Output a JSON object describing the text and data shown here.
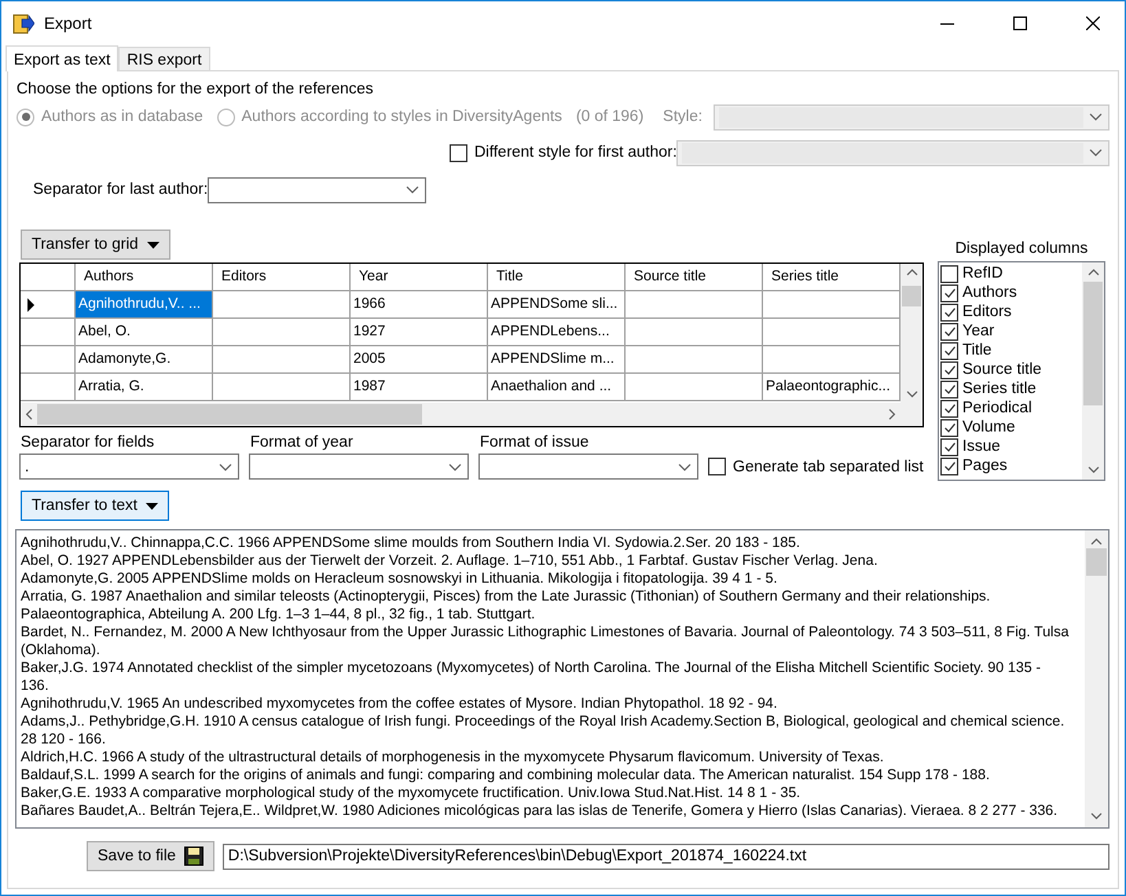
{
  "window": {
    "title": "Export"
  },
  "tabs": [
    {
      "label": "Export as text",
      "selected": true
    },
    {
      "label": "RIS export",
      "selected": false
    }
  ],
  "options": {
    "heading": "Choose the options for the export of the references",
    "author_modes": [
      {
        "label": "Authors as in database",
        "selected": true,
        "disabled": true
      },
      {
        "label": "Authors according to styles in DiversityAgents",
        "selected": false,
        "disabled": true
      }
    ],
    "count": "(0 of 196)",
    "style": {
      "label": "Style:",
      "disabled": true
    },
    "first_author": {
      "label": "Different style for first author:",
      "checked": false,
      "combo_disabled": true
    },
    "separator_last_author": {
      "label": "Separator for last author:"
    }
  },
  "transfer_grid": {
    "label": "Transfer to grid"
  },
  "grid": {
    "columns": [
      "Authors",
      "Editors",
      "Year",
      "Title",
      "Source title",
      "Series title"
    ],
    "rows": [
      {
        "selected": true,
        "cells": [
          "Agnihothrudu,V.. ...",
          "",
          "1966",
          "APPENDSome sli...",
          "",
          ""
        ]
      },
      {
        "selected": false,
        "cells": [
          "Abel, O.",
          "",
          "1927",
          "APPENDLebens...",
          "",
          ""
        ]
      },
      {
        "selected": false,
        "cells": [
          "Adamonyte,G.",
          "",
          "2005",
          "APPENDSlime m...",
          "",
          ""
        ]
      },
      {
        "selected": false,
        "cells": [
          "Arratia, G.",
          "",
          "1987",
          "Anaethalion and ...",
          "",
          "Palaeontographic..."
        ]
      }
    ]
  },
  "displayed_columns": {
    "label": "Displayed columns",
    "items": [
      {
        "label": "RefID",
        "checked": false
      },
      {
        "label": "Authors",
        "checked": true
      },
      {
        "label": "Editors",
        "checked": true
      },
      {
        "label": "Year",
        "checked": true
      },
      {
        "label": "Title",
        "checked": true
      },
      {
        "label": "Source title",
        "checked": true
      },
      {
        "label": "Series title",
        "checked": true
      },
      {
        "label": "Periodical",
        "checked": true
      },
      {
        "label": "Volume",
        "checked": true
      },
      {
        "label": "Issue",
        "checked": true
      },
      {
        "label": "Pages",
        "checked": true
      }
    ]
  },
  "format": {
    "separator_fields": {
      "label": "Separator for fields",
      "value": "."
    },
    "year": {
      "label": "Format of year"
    },
    "issue": {
      "label": "Format of issue"
    },
    "tab_list": {
      "label": "Generate tab separated list",
      "checked": false
    }
  },
  "transfer_text": {
    "label": "Transfer to text"
  },
  "output": {
    "lines": [
      "Agnihothrudu,V.. Chinnappa,C.C. 1966 APPENDSome slime moulds from Southern India VI. Sydowia.2.Ser. 20 183 - 185.",
      "Abel, O. 1927 APPENDLebensbilder aus der Tierwelt der Vorzeit. 2. Auflage. 1–710, 551 Abb., 1 Farbtaf. Gustav Fischer Verlag. Jena.",
      "Adamonyte,G. 2005 APPENDSlime molds on Heracleum sosnowskyi in Lithuania. Mikologija i fitopatologija. 39 4 1 - 5.",
      "Arratia, G. 1987 Anaethalion and similar teleosts (Actinopterygii, Pisces) from the Late Jurassic (Tithonian) of Southern Germany and their relationships.",
      "Palaeontographica, Abteilung A. 200 Lfg. 1–3 1–44, 8 pl., 32 fig., 1 tab. Stuttgart.",
      "Bardet, N.. Fernandez, M. 2000 A New Ichthyosaur from the Upper Jurassic Lithographic Limestones of Bavaria. Journal of Paleontology. 74 3 503–511, 8 Fig. Tulsa",
      "(Oklahoma).",
      "Baker,J.G. 1974 Annotated checklist of the simpler mycetozoans (Myxomycetes) of North Carolina. The Journal of the Elisha Mitchell Scientific Society. 90 135 -",
      "136.",
      "Agnihothrudu,V. 1965 An undescribed myxomycetes from the coffee estates of Mysore. Indian Phytopathol. 18 92 - 94.",
      "Adams,J.. Pethybridge,G.H. 1910 A census catalogue of Irish fungi. Proceedings of the Royal Irish Academy.Section B, Biological, geological and chemical science.",
      "28 120 - 166.",
      "Aldrich,H.C. 1966 A study of the ultrastructural details of morphogenesis in the myxomycete Physarum flavicomum. University of Texas.",
      "Baldauf,S.L. 1999 A search for the origins of animals and fungi: comparing and combining molecular data. The American naturalist. 154 Supp 178 - 188.",
      "Baker,G.E. 1933 A comparative morphological study of the myxomycete fructification. Univ.Iowa Stud.Nat.Hist. 14 8 1 - 35.",
      "Bañares Baudet,A.. Beltrán Tejera,E.. Wildpret,W. 1980 Adiciones micológicas para las islas de Tenerife, Gomera y Hierro (Islas Canarias). Vieraea. 8 2 277 - 336."
    ]
  },
  "save": {
    "label": "Save to file",
    "path": "D:\\Subversion\\Projekte\\DiversityReferences\\bin\\Debug\\Export_201874_160224.txt"
  }
}
